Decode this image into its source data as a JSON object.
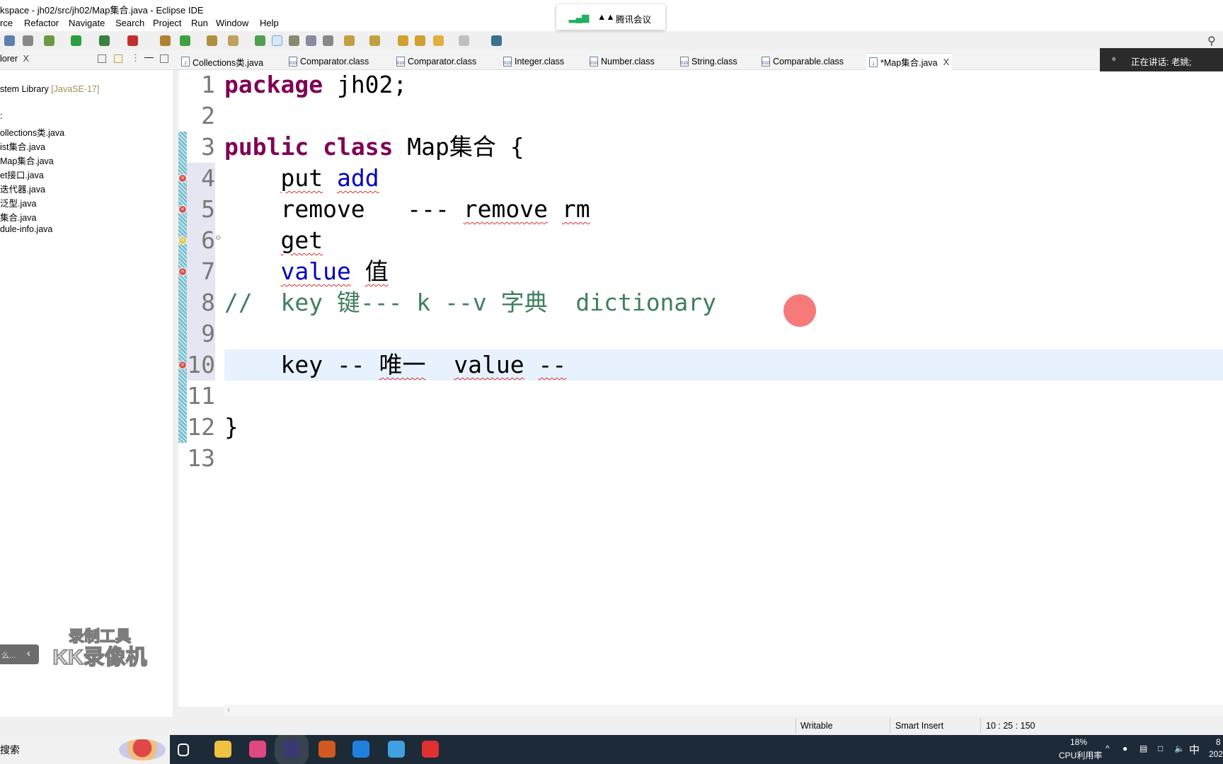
{
  "window": {
    "title": "kspace - jh02/src/jh02/Map集合.java - Eclipse IDE"
  },
  "menu": [
    "rce",
    "Refactor",
    "Navigate",
    "Search",
    "Project",
    "Run",
    "Window",
    "Help"
  ],
  "tabs": [
    {
      "label": "Collections类.java",
      "icon": "java-file-icon",
      "active": false
    },
    {
      "label": "Comparator.class",
      "icon": "class-file-icon",
      "active": false
    },
    {
      "label": "Comparator.class",
      "icon": "class-file-icon",
      "active": false
    },
    {
      "label": "Integer.class",
      "icon": "class-file-icon",
      "active": false
    },
    {
      "label": "Number.class",
      "icon": "class-file-icon",
      "active": false
    },
    {
      "label": "String.class",
      "icon": "class-file-icon",
      "active": false
    },
    {
      "label": "Comparable.class",
      "icon": "class-file-icon",
      "active": false
    },
    {
      "label": "*Map集合.java",
      "icon": "java-file-icon",
      "active": true,
      "close": "X"
    }
  ],
  "explorer": {
    "title": "lorer",
    "close": "X",
    "library": "stem Library",
    "library_tag": "[JavaSE-17]",
    "package_fragment": ":",
    "files": [
      "ollections类.java",
      "ist集合.java",
      "Map集合.java",
      "et接口.java",
      "迭代器.java",
      "泛型.java",
      "集合.java",
      "dule-info.java"
    ]
  },
  "editor": {
    "lines": [
      [
        {
          "t": "package",
          "c": "kw"
        },
        {
          "t": " jh02;"
        }
      ],
      [],
      [
        {
          "t": "public",
          "c": "kw"
        },
        {
          "t": " "
        },
        {
          "t": "class",
          "c": "kw"
        },
        {
          "t": " Map集合 {"
        }
      ],
      [
        {
          "t": "    "
        },
        {
          "t": "put",
          "c": "err"
        },
        {
          "t": " "
        },
        {
          "t": "add",
          "c": "fld err"
        }
      ],
      [
        {
          "t": "    remove   --- "
        },
        {
          "t": "remove",
          "c": "err"
        },
        {
          "t": " "
        },
        {
          "t": "rm",
          "c": "err"
        }
      ],
      [
        {
          "t": "    "
        },
        {
          "t": "get",
          "c": "err"
        }
      ],
      [
        {
          "t": "    "
        },
        {
          "t": "value",
          "c": "fld err"
        },
        {
          "t": " "
        },
        {
          "t": "值",
          "c": "err"
        }
      ],
      [
        {
          "t": "//  key 键--- k --v 字典  dictionary",
          "c": "cm"
        }
      ],
      [],
      [
        {
          "t": "    key -- "
        },
        {
          "t": "唯一",
          "c": "err"
        },
        {
          "t": "  "
        },
        {
          "t": "value",
          "c": "err"
        },
        {
          "t": " "
        },
        {
          "t": "--",
          "c": "err"
        }
      ],
      [],
      [
        {
          "t": "}"
        }
      ],
      []
    ],
    "error_lines": [
      4,
      5,
      7,
      10
    ],
    "warning_lines": [
      6
    ],
    "current_line": 10,
    "colors": {
      "keyword": "#7f0055",
      "field": "#0000c0",
      "comment": "#3f7f5f",
      "error_underline": "#d43030"
    }
  },
  "status": {
    "writable": "Writable",
    "insert_mode": "Smart Insert",
    "position": "10 : 25 : 150"
  },
  "meeting": {
    "app": "腾讯会议",
    "speaking": "正在讲话: 老姚;"
  },
  "watermark": {
    "line1": "录制工具",
    "line2": "KK录像机"
  },
  "pill": {
    "text": "么..."
  },
  "taskbar": {
    "search": "搜索",
    "cpu_percent": "18%",
    "cpu_label": "CPU利用率",
    "ime": "中",
    "clock_time": "8",
    "clock_date": "202",
    "apps": [
      "task-view-icon",
      "file-explorer-icon",
      "browser-icon",
      "eclipse-icon",
      "app-icon",
      "tencent-meeting-icon",
      "contacts-icon",
      "wps-icon"
    ]
  }
}
